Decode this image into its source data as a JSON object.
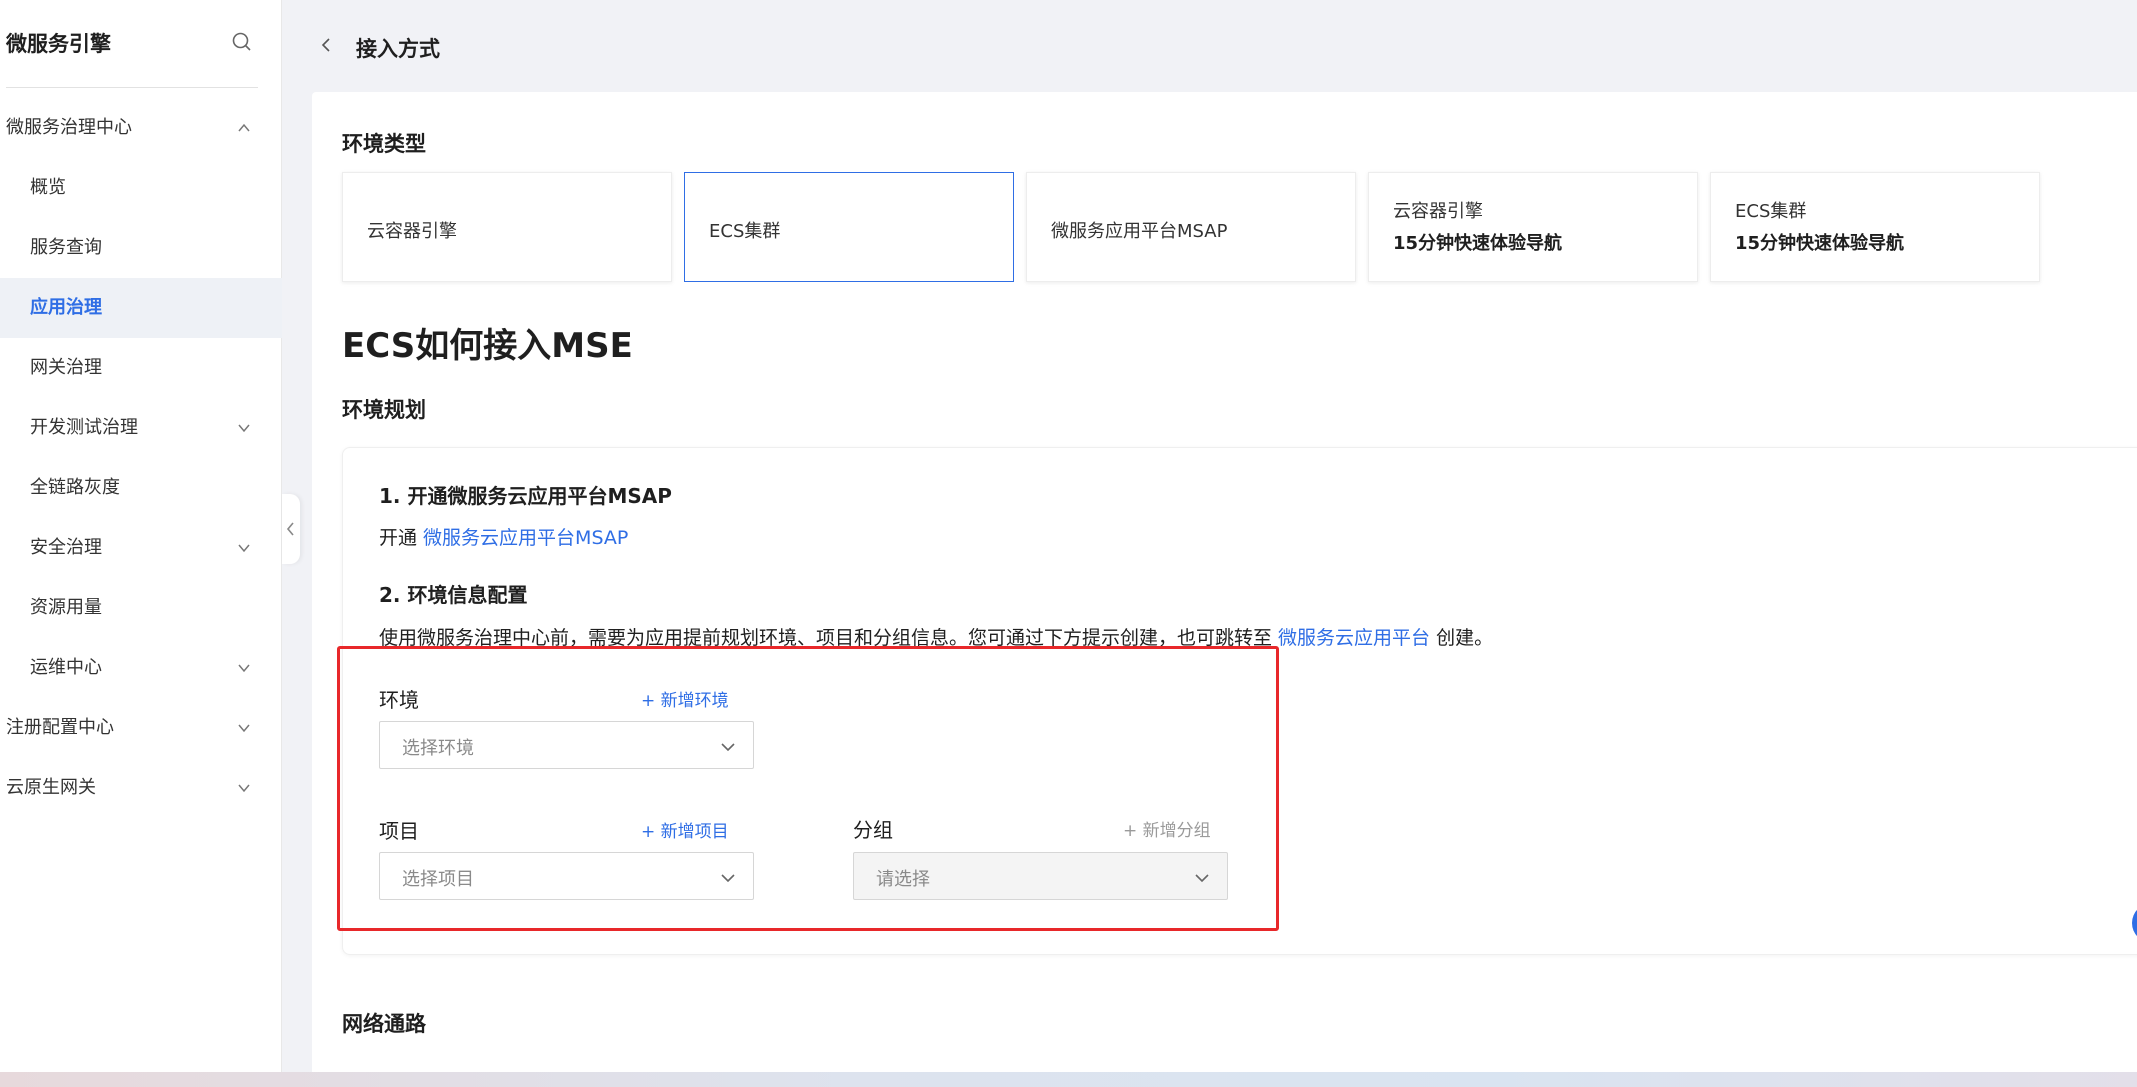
{
  "sidebar": {
    "brand": "微服务引擎",
    "items": [
      {
        "label": "微服务治理中心",
        "level": 1,
        "chevron": "up",
        "active": false
      },
      {
        "label": "概览",
        "level": 2,
        "chevron": "",
        "active": false
      },
      {
        "label": "服务查询",
        "level": 2,
        "chevron": "",
        "active": false
      },
      {
        "label": "应用治理",
        "level": 2,
        "chevron": "",
        "active": true
      },
      {
        "label": "网关治理",
        "level": 2,
        "chevron": "",
        "active": false
      },
      {
        "label": "开发测试治理",
        "level": 2,
        "chevron": "down",
        "active": false
      },
      {
        "label": "全链路灰度",
        "level": 2,
        "chevron": "",
        "active": false
      },
      {
        "label": "安全治理",
        "level": 2,
        "chevron": "down",
        "active": false
      },
      {
        "label": "资源用量",
        "level": 2,
        "chevron": "",
        "active": false
      },
      {
        "label": "运维中心",
        "level": 2,
        "chevron": "down",
        "active": false
      },
      {
        "label": "注册配置中心",
        "level": 1,
        "chevron": "down",
        "active": false
      },
      {
        "label": "云原生网关",
        "level": 1,
        "chevron": "down",
        "active": false
      }
    ]
  },
  "header": {
    "title": "接入方式"
  },
  "env_type": {
    "title": "环境类型",
    "cards": [
      {
        "title": "云容器引擎",
        "subtitle": "",
        "selected": false
      },
      {
        "title": "ECS集群",
        "subtitle": "",
        "selected": true
      },
      {
        "title": "微服务应用平台MSAP",
        "subtitle": "",
        "selected": false
      },
      {
        "title": "云容器引擎",
        "subtitle": "15分钟快速体验导航",
        "selected": false
      },
      {
        "title": "ECS集群",
        "subtitle": "15分钟快速体验导航",
        "selected": false
      }
    ]
  },
  "main_title": "ECS如何接入MSE",
  "env_plan": {
    "title": "环境规划",
    "step1_title": "1. 开通微服务云应用平台MSAP",
    "step1_prefix": "开通 ",
    "step1_link": "微服务云应用平台MSAP",
    "step2_title": "2. 环境信息配置",
    "step2_text": "使用微服务治理中心前，需要为应用提前规划环境、项目和分组信息。您可通过下方提示创建，也可跳转至 ",
    "step2_link": "微服务云应用平台",
    "step2_suffix": " 创建。"
  },
  "form": {
    "env_label": "环境",
    "env_add": "+ 新增环境",
    "env_placeholder": "选择环境",
    "project_label": "项目",
    "project_add": "+ 新增项目",
    "project_placeholder": "选择项目",
    "group_label": "分组",
    "group_add": "+ 新增分组",
    "group_placeholder": "请选择"
  },
  "network": {
    "title": "网络通路"
  },
  "colors": {
    "accent": "#2f6ee5",
    "highlight": "#e8282a"
  }
}
